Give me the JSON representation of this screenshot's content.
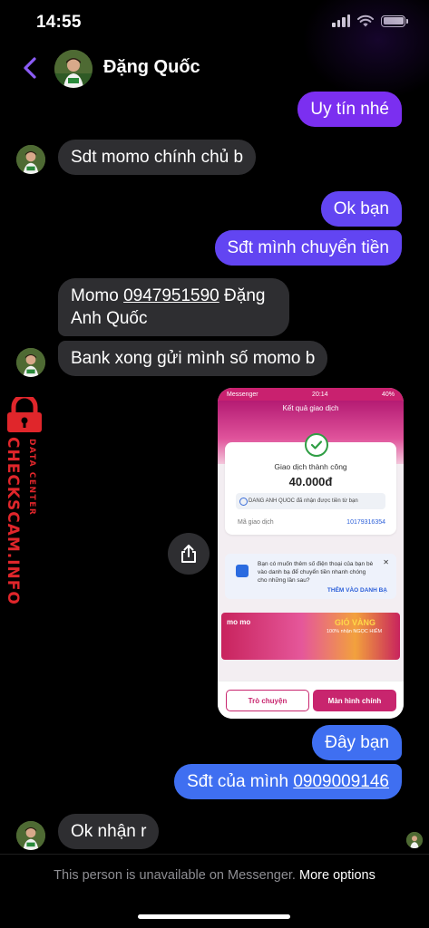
{
  "status_bar": {
    "time": "14:55",
    "icons": [
      "signal-icon",
      "wifi-icon",
      "battery-icon"
    ]
  },
  "header": {
    "contact_name": "Đặng Quốc",
    "back_icon": "chevron-left-icon"
  },
  "messages": [
    {
      "id": "m1",
      "side": "out",
      "text": "Uy tín nhé"
    },
    {
      "id": "m2",
      "side": "in",
      "text": "Sdt momo chính chủ b"
    },
    {
      "id": "m3",
      "side": "out",
      "text": "Ok bạn"
    },
    {
      "id": "m4",
      "side": "out",
      "text": "Sđt mình chuyển tiền"
    },
    {
      "id": "m5",
      "side": "in",
      "text_before": "Momo ",
      "phone": "0947951590",
      "text_after_line1": " Đặng",
      "line2": "Anh Quốc"
    },
    {
      "id": "m6",
      "side": "in",
      "text": "Bank xong gửi mình số momo b"
    },
    {
      "id": "m7",
      "side": "out",
      "text": "Đây bạn"
    },
    {
      "id": "m8",
      "side": "out",
      "text_before": "Sđt của mình ",
      "phone": "0909009146"
    },
    {
      "id": "m9",
      "side": "in",
      "text": "Ok nhận r"
    }
  ],
  "attachment": {
    "status_left": "Messenger",
    "status_time": "20:14",
    "status_battery": "40%",
    "title": "Kết quả giao dịch",
    "success": "Giao dịch thành công",
    "amount": "40.000đ",
    "note": "DANG ANH QUOC đã nhận được tiền từ bạn",
    "code_label": "Mã giao dịch",
    "code_value": "10179316354",
    "contact_text": "Bạn có muốn thêm số điện thoại của bạn bè vào danh bạ để chuyển tiền nhanh chóng cho những lần sau?",
    "contact_link": "THÊM VÀO DANH BẠ",
    "promo_brand": "mo mo",
    "promo_gold": "GIÓ VÀNG",
    "promo_sub": "100% nhận NGỌC HIẾM",
    "btn_chat": "Trò chuyện",
    "btn_main": "Màn hình chính"
  },
  "watermark": {
    "main": "CHECKSCAM.INFO",
    "sub": "DATA CENTER"
  },
  "footer": {
    "notice": "This person is unavailable on Messenger.",
    "more": "More options"
  },
  "colors": {
    "outgoing_purple": "#7b2ff0",
    "outgoing_violet": "#6245f2",
    "outgoing_blue": "#3f6ff1",
    "incoming": "#2e2e31",
    "accent_back": "#8b5cf6",
    "watermark": "#e0262b"
  }
}
